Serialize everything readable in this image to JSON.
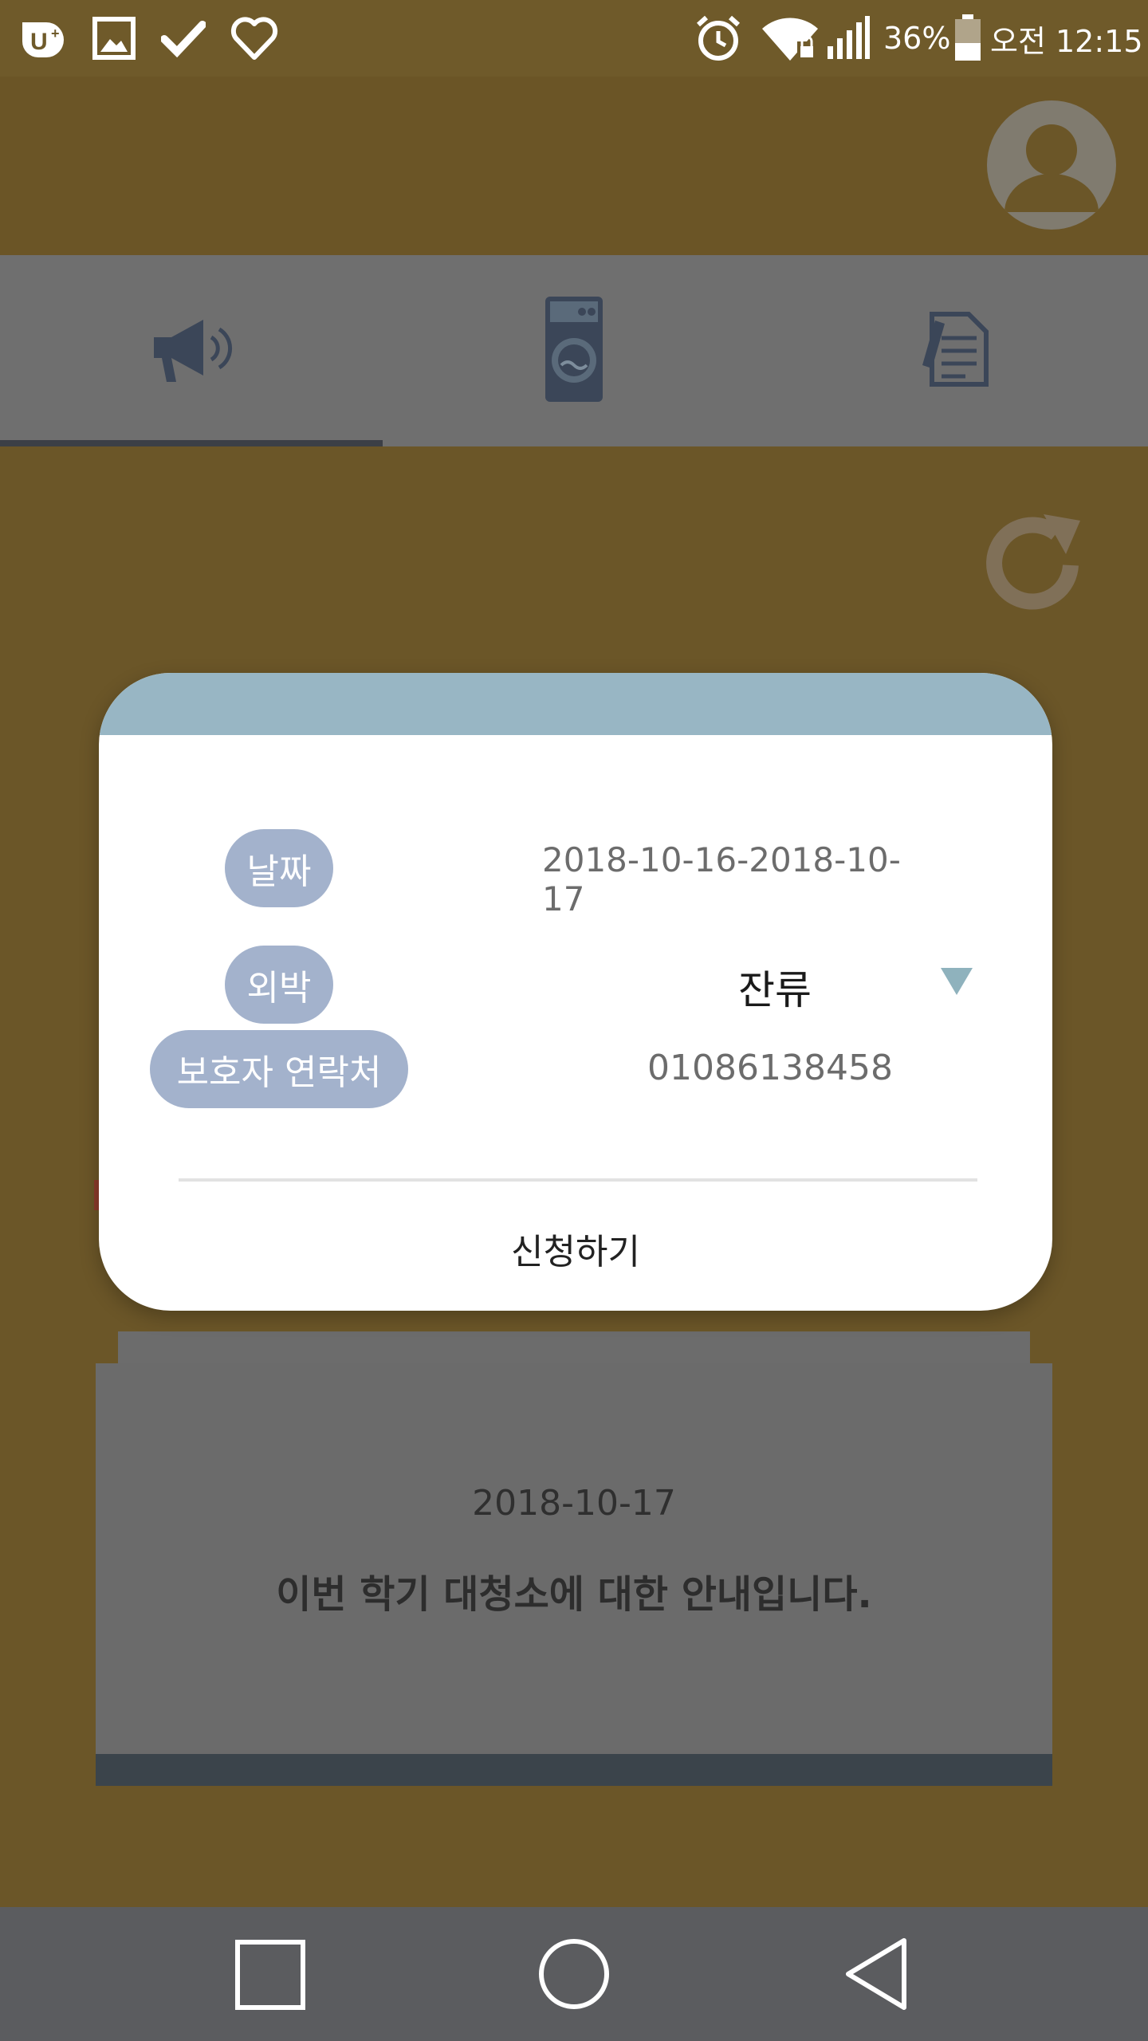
{
  "status_bar": {
    "battery": "36%",
    "time": "오전 12:15",
    "icons": [
      "uplus-icon",
      "image-icon",
      "check-icon",
      "heart-icon",
      "alarm-icon",
      "wifi-lock-icon",
      "signal-icon",
      "battery-icon"
    ]
  },
  "tabs": [
    {
      "name": "notice",
      "icon": "megaphone-icon",
      "selected": true
    },
    {
      "name": "laundry",
      "icon": "washing-machine-icon",
      "selected": false
    },
    {
      "name": "application",
      "icon": "document-pen-icon",
      "selected": false
    }
  ],
  "dialog": {
    "date_label": "날짜",
    "date_value": "2018-10-16-2018-10-17",
    "stay_label": "외박",
    "stay_value": "잔류",
    "guardian_label": "보호자 연락처",
    "guardian_value": "01086138458",
    "submit_label": "신청하기"
  },
  "notice_card": {
    "date": "2018-10-17",
    "title": "이번 학기 대청소에 대한 안내입니다."
  },
  "nav_bar": {
    "icons": [
      "recent-apps-icon",
      "home-icon",
      "back-icon"
    ]
  }
}
